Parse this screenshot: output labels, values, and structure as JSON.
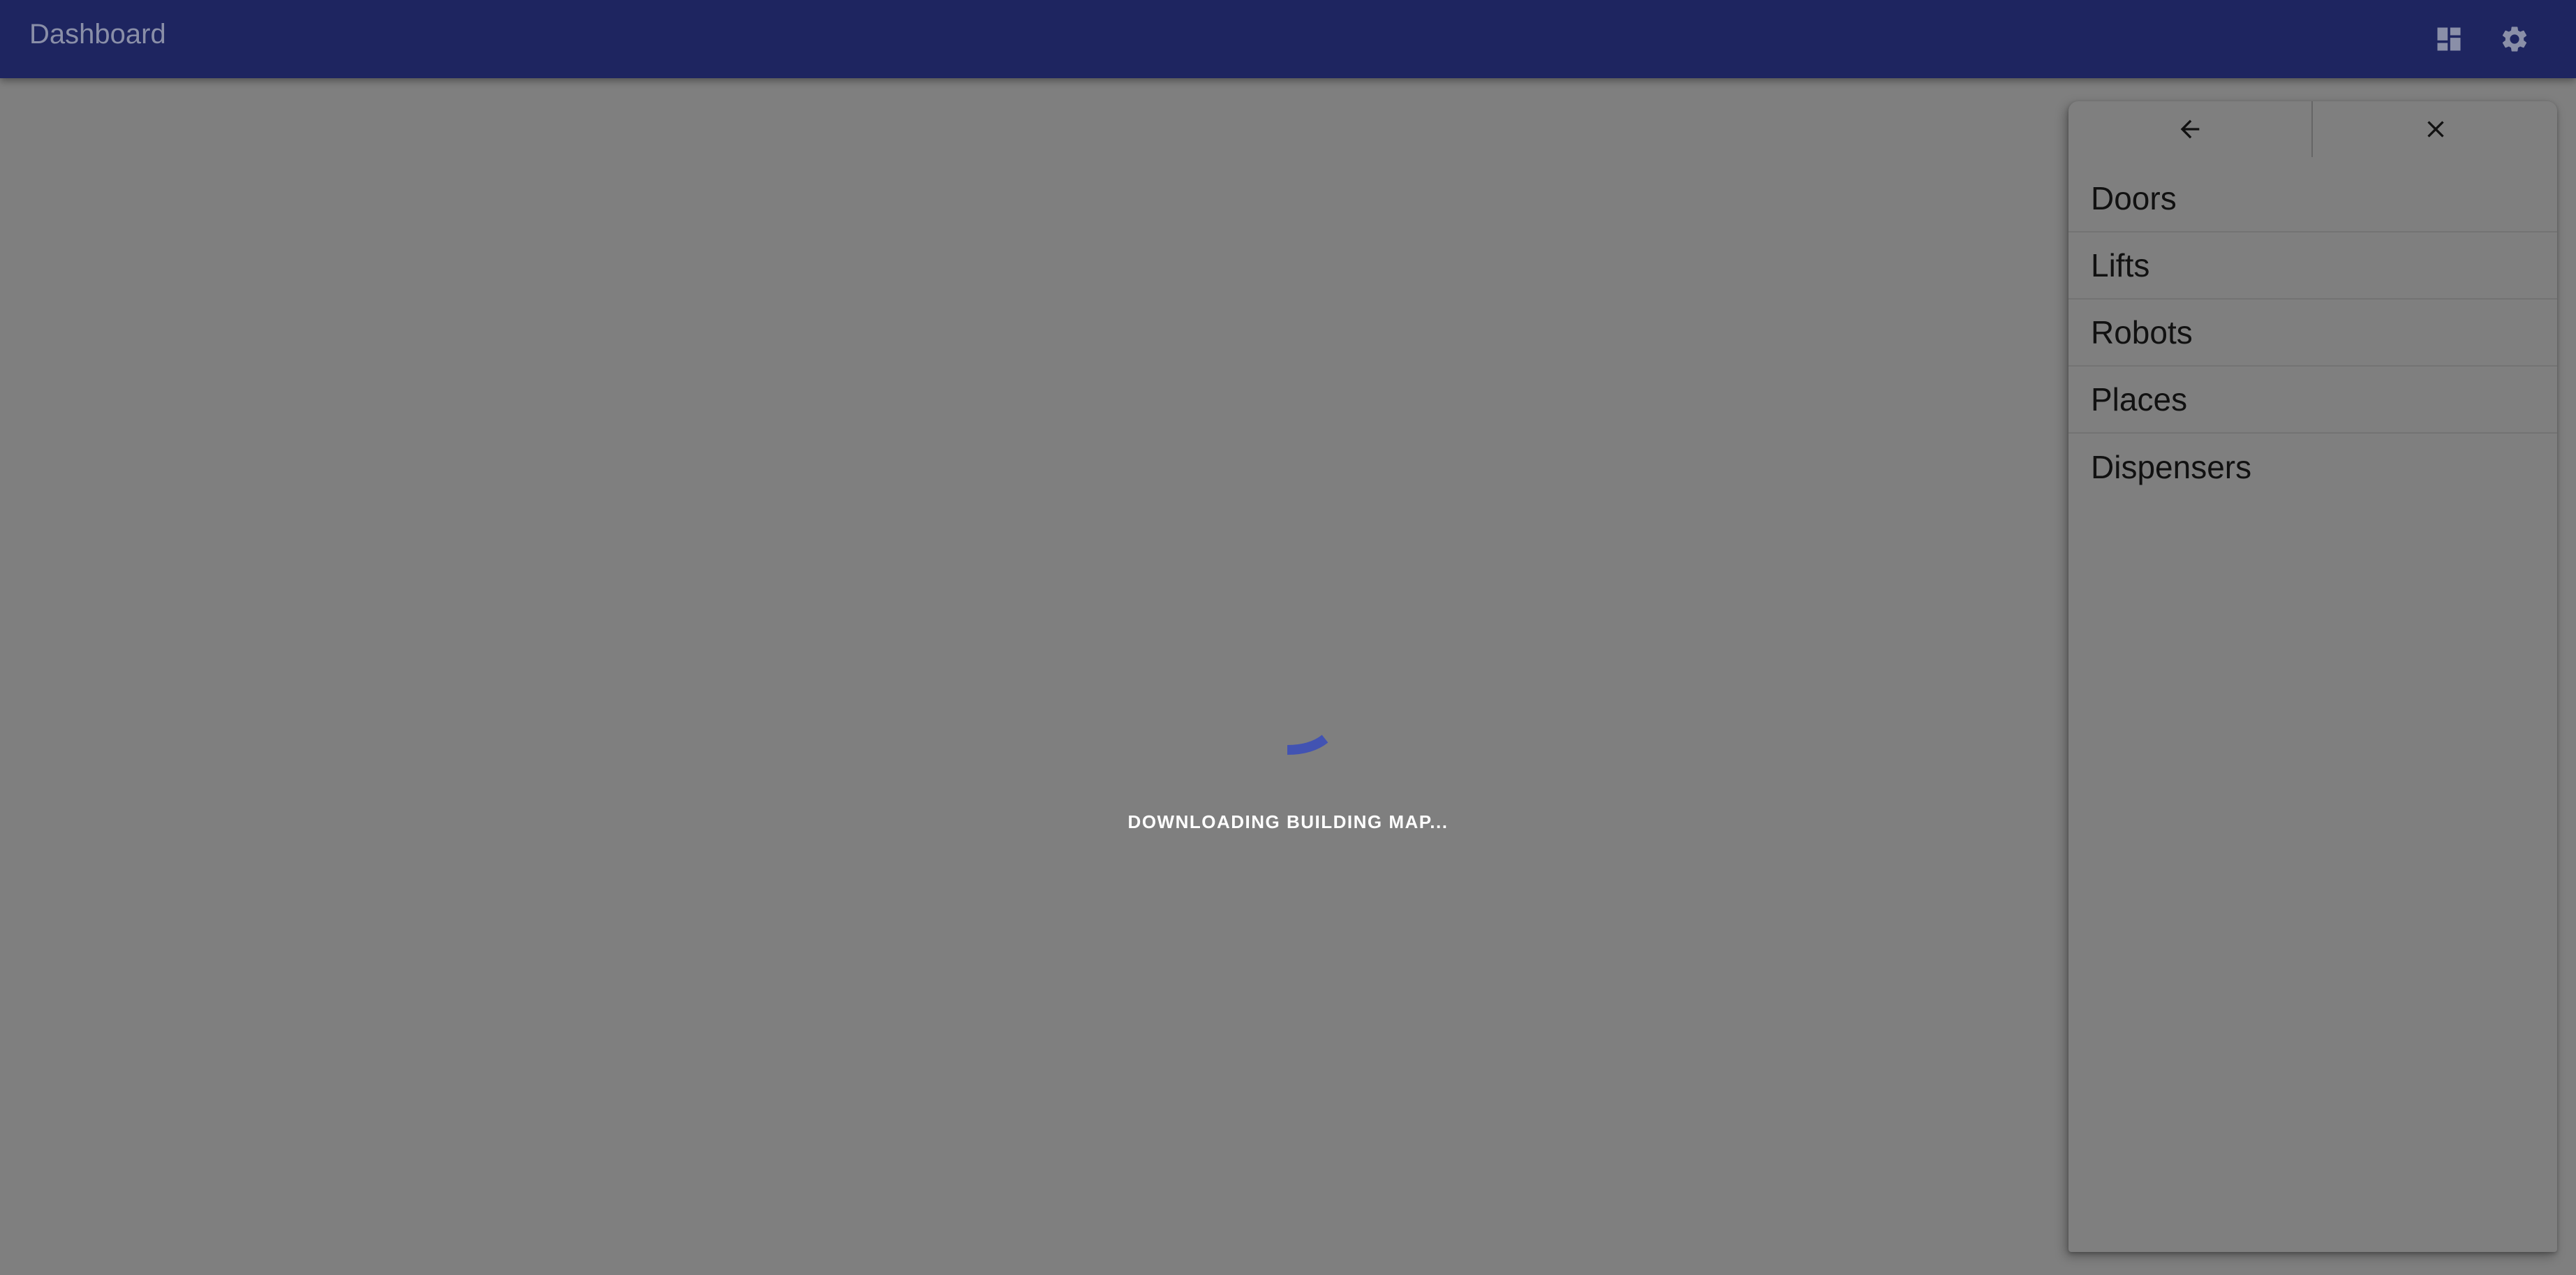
{
  "appbar": {
    "title": "Dashboard",
    "icons": {
      "dashboard": "dashboard-icon",
      "settings": "gear-icon"
    },
    "background_color": "#1e2560"
  },
  "map": {
    "loading_text": "DOWNLOADING BUILDING MAP...",
    "spinner_color": "#3f51b5"
  },
  "panel": {
    "back_icon": "arrow-left-icon",
    "close_icon": "close-icon",
    "items": [
      {
        "label": "Doors"
      },
      {
        "label": "Lifts"
      },
      {
        "label": "Robots"
      },
      {
        "label": "Places"
      },
      {
        "label": "Dispensers"
      }
    ]
  }
}
